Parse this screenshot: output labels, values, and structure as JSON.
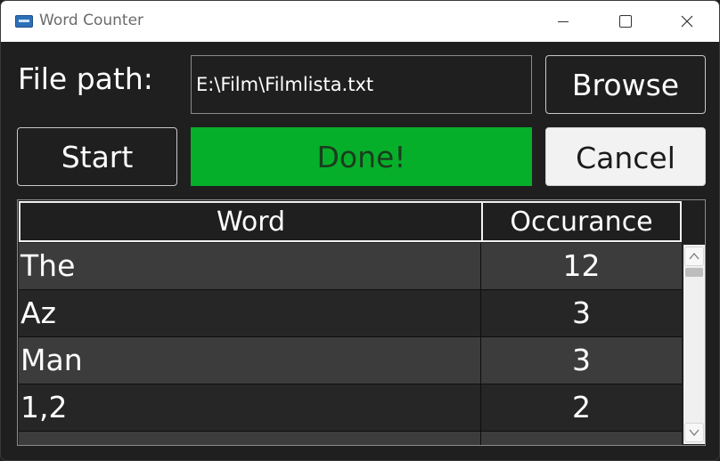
{
  "window": {
    "title": "Word Counter"
  },
  "form": {
    "filepath_label": "File path:",
    "filepath_value": "E:\\Film\\Filmlista.txt",
    "browse_label": "Browse",
    "start_label": "Start",
    "status_text": "Done!",
    "cancel_label": "Cancel"
  },
  "grid": {
    "columns": [
      "Word",
      "Occurance"
    ],
    "rows": [
      {
        "word": "The",
        "count": "12"
      },
      {
        "word": "Az",
        "count": "3"
      },
      {
        "word": "Man",
        "count": "3"
      },
      {
        "word": "1,2",
        "count": "2"
      }
    ]
  },
  "icons": {
    "app": "app-icon",
    "minimize": "minimize-icon",
    "maximize": "maximize-icon",
    "close": "close-icon",
    "scroll_up": "chevron-up-icon",
    "scroll_down": "chevron-down-icon"
  },
  "colors": {
    "status_bg": "#06af2a",
    "window_bg": "#1f1f1f",
    "row_alt": "#3c3c3c"
  }
}
